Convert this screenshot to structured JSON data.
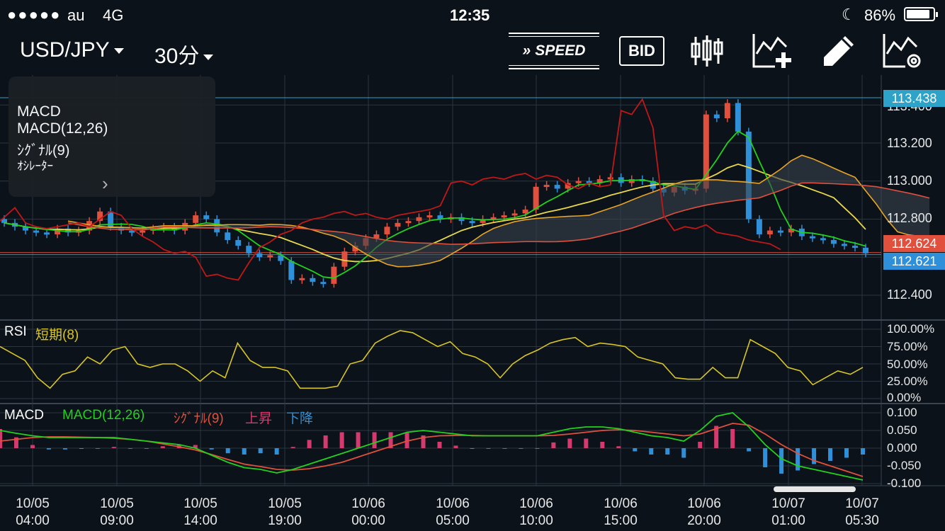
{
  "status_bar": {
    "signal": "●●●●●",
    "carrier": "au",
    "network": "4G",
    "time": "12:35",
    "moon": "☾",
    "battery": "86%"
  },
  "toolbar": {
    "symbol": "USD/JPY",
    "period": "30分",
    "speed_label": "SPEED",
    "bid_label": "BID"
  },
  "prices": {
    "last": "113.438",
    "ask": "112.624",
    "bid": "112.621"
  },
  "info_box": {
    "title": "MACD",
    "line1": "MACD(12,26)",
    "line2": "ｼｸﾞﾅﾙ(9)",
    "line3": "ｵｼﾚｰﾀｰ",
    "arrow": "›"
  },
  "main_axis": [
    "113.400",
    "113.200",
    "113.000",
    "112.800",
    "112.400"
  ],
  "rsi_panel": {
    "name": "RSI",
    "label": "短期(8)",
    "axis": [
      "100.00%",
      "75.00%",
      "50.00%",
      "25.00%",
      "0.00%"
    ]
  },
  "macd_panel": {
    "name": "MACD",
    "macd_label": "MACD(12,26)",
    "signal_label": "ｼｸﾞﾅﾙ(9)",
    "up_label": "上昇",
    "down_label": "下降",
    "axis": [
      "0.100",
      "0.050",
      "0.000",
      "-0.050",
      "-0.100"
    ]
  },
  "x_axis": [
    {
      "date": "10/05",
      "time": "04:00"
    },
    {
      "date": "10/05",
      "time": "09:00"
    },
    {
      "date": "10/05",
      "time": "14:00"
    },
    {
      "date": "10/05",
      "time": "19:00"
    },
    {
      "date": "10/06",
      "time": "00:00"
    },
    {
      "date": "10/06",
      "time": "05:00"
    },
    {
      "date": "10/06",
      "time": "10:00"
    },
    {
      "date": "10/06",
      "time": "15:00"
    },
    {
      "date": "10/06",
      "time": "20:00"
    },
    {
      "date": "10/07",
      "time": "01:00"
    },
    {
      "date": "10/07",
      "time": "05:30"
    }
  ],
  "chart_data": {
    "type": "candlestick",
    "title": "USD/JPY 30分",
    "series_colors": {
      "up": "#e0503c",
      "down": "#2f8fd8",
      "macd": "#22d11d",
      "signal": "#e0503c",
      "rsi": "#d8c526",
      "lagging": "#c01818",
      "cloud": "#e8a526"
    },
    "close": [
      112.78,
      112.76,
      112.74,
      112.73,
      112.72,
      112.75,
      112.73,
      112.74,
      112.79,
      112.84,
      112.76,
      112.74,
      112.73,
      112.74,
      112.75,
      112.76,
      112.74,
      112.78,
      112.82,
      112.8,
      112.73,
      112.69,
      112.66,
      112.62,
      112.6,
      112.61,
      112.58,
      112.48,
      112.49,
      112.47,
      112.46,
      112.55,
      112.63,
      112.66,
      112.7,
      112.72,
      112.76,
      112.78,
      112.79,
      112.81,
      112.82,
      112.8,
      112.81,
      112.79,
      112.78,
      112.8,
      112.81,
      112.82,
      112.83,
      112.85,
      112.97,
      112.98,
      112.96,
      112.99,
      113.0,
      112.99,
      113.01,
      113.02,
      112.99,
      113.01,
      113.0,
      112.96,
      112.94,
      112.97,
      112.95,
      112.96,
      113.35,
      113.33,
      113.41,
      113.26,
      112.8,
      112.72,
      112.74,
      112.73,
      112.75,
      112.71,
      112.7,
      112.69,
      112.67,
      112.66,
      112.65,
      112.62
    ],
    "rsi": [
      75,
      65,
      55,
      30,
      15,
      35,
      40,
      60,
      50,
      70,
      75,
      50,
      45,
      50,
      50,
      40,
      25,
      40,
      30,
      80,
      55,
      45,
      45,
      40,
      15,
      15,
      15,
      18,
      50,
      55,
      80,
      90,
      98,
      95,
      85,
      75,
      82,
      65,
      60,
      50,
      30,
      50,
      62,
      70,
      80,
      85,
      88,
      75,
      80,
      78,
      75,
      60,
      55,
      50,
      30,
      28,
      28,
      45,
      30,
      30,
      85,
      75,
      65,
      45,
      40,
      20,
      30,
      40,
      35,
      45
    ],
    "macd": [
      0.05,
      0.042,
      0.035,
      0.03,
      0.03,
      0.03,
      0.03,
      0.03,
      0.025,
      0.02,
      0.015,
      0.01,
      0.0,
      -0.02,
      -0.04,
      -0.055,
      -0.06,
      -0.07,
      -0.06,
      -0.045,
      -0.03,
      -0.015,
      0.0,
      0.015,
      0.03,
      0.045,
      0.05,
      0.045,
      0.04,
      0.035,
      0.035,
      0.035,
      0.035,
      0.035,
      0.045,
      0.055,
      0.06,
      0.06,
      0.055,
      0.045,
      0.035,
      0.03,
      0.02,
      0.05,
      0.09,
      0.1,
      0.06,
      0.01,
      -0.03,
      -0.05,
      -0.06,
      -0.07,
      -0.08,
      -0.09
    ],
    "signal": [
      0.02,
      0.025,
      0.03,
      0.032,
      0.032,
      0.031,
      0.03,
      0.028,
      0.025,
      0.02,
      0.012,
      0.004,
      -0.005,
      -0.018,
      -0.032,
      -0.045,
      -0.052,
      -0.06,
      -0.062,
      -0.058,
      -0.05,
      -0.04,
      -0.025,
      -0.01,
      0.005,
      0.02,
      0.03,
      0.035,
      0.036,
      0.036,
      0.035,
      0.035,
      0.035,
      0.035,
      0.036,
      0.04,
      0.045,
      0.05,
      0.052,
      0.05,
      0.045,
      0.04,
      0.035,
      0.04,
      0.055,
      0.07,
      0.065,
      0.04,
      0.01,
      -0.015,
      -0.035,
      -0.05,
      -0.065,
      -0.08
    ]
  }
}
